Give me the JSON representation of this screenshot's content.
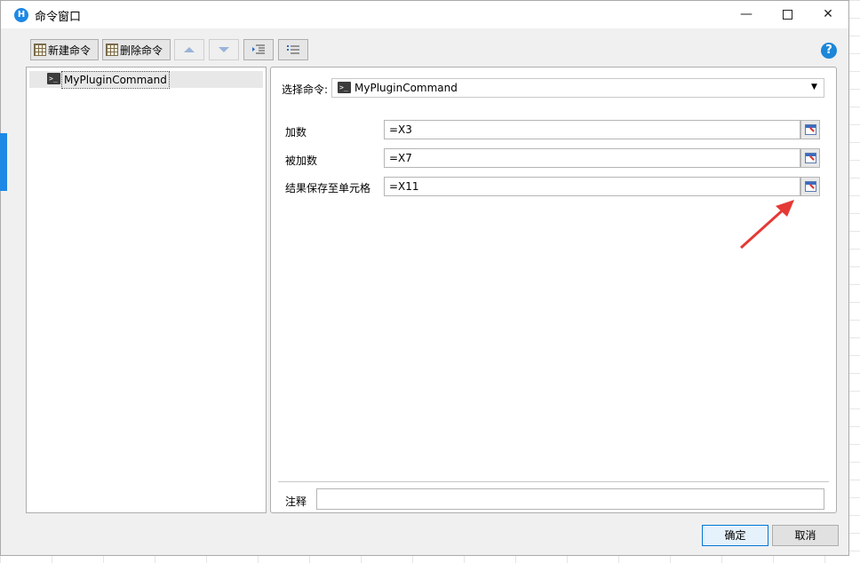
{
  "window": {
    "title": "命令窗口",
    "app_icon_text": "H"
  },
  "toolbar": {
    "new_command": "新建命令",
    "delete_command": "删除命令"
  },
  "help_icon_text": "?",
  "tree": {
    "selected_item": "MyPluginCommand"
  },
  "command": {
    "label": "选择命令:",
    "selected": "MyPluginCommand"
  },
  "params": [
    {
      "label": "加数",
      "value": "=X3"
    },
    {
      "label": "被加数",
      "value": "=X7"
    },
    {
      "label": "结果保存至单元格",
      "value": "=X11"
    }
  ],
  "comment": {
    "label": "注释",
    "value": ""
  },
  "footer": {
    "ok": "确定",
    "cancel": "取消"
  },
  "colors": {
    "accent": "#1c86d8",
    "annotation_arrow": "#e53935"
  }
}
